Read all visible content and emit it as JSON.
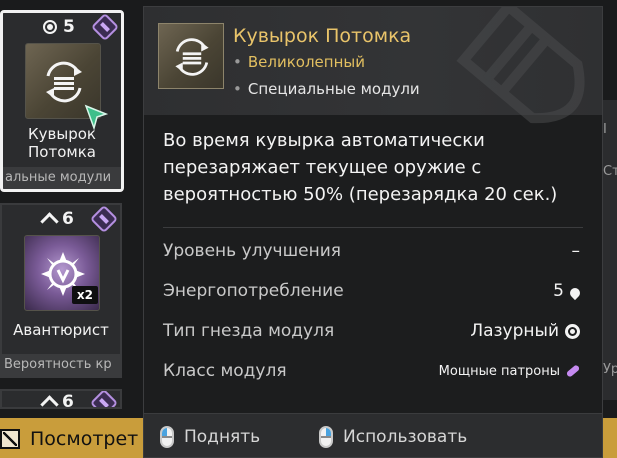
{
  "cards": [
    {
      "cost": "5",
      "name_line1": "Кувырок",
      "name_line2": "Потомка",
      "footer": "альные модули"
    },
    {
      "cost": "6",
      "name": "Авантюрист",
      "count": "x2",
      "footer": "Вероятность кр"
    },
    {
      "cost": "6"
    }
  ],
  "edge_fragments": [
    "I",
    "Ст",
    "Ур"
  ],
  "bottom_bar": {
    "view_label": "Посмотрет",
    "color": "#c99d3b"
  },
  "tooltip": {
    "title": "Кувырок Потомка",
    "rarity": "Великолепный",
    "category": "Специальные модули",
    "description": "Во время кувырка автоматически перезаряжает текущее оружие с вероятностью 50% (перезарядка 20 сек.)",
    "stats": [
      {
        "label": "Уровень улучшения",
        "value": "–",
        "icon": ""
      },
      {
        "label": "Энергопотребление",
        "value": "5",
        "icon": "drop-icon"
      },
      {
        "label": "Тип гнезда модуля",
        "value": "Лазурный",
        "icon": "socket-icon"
      },
      {
        "label": "Класс модуля",
        "value": "Мощные патроны",
        "icon": "ammo-icon"
      }
    ],
    "actions": [
      {
        "label": "Поднять",
        "icon": "mouse-left-click-icon"
      },
      {
        "label": "Использовать",
        "icon": "mouse-right-click-icon"
      }
    ],
    "colors": {
      "title": "#e9c46a",
      "rarity": "#e2bf60",
      "module_class_accent": "#c58af0"
    }
  }
}
